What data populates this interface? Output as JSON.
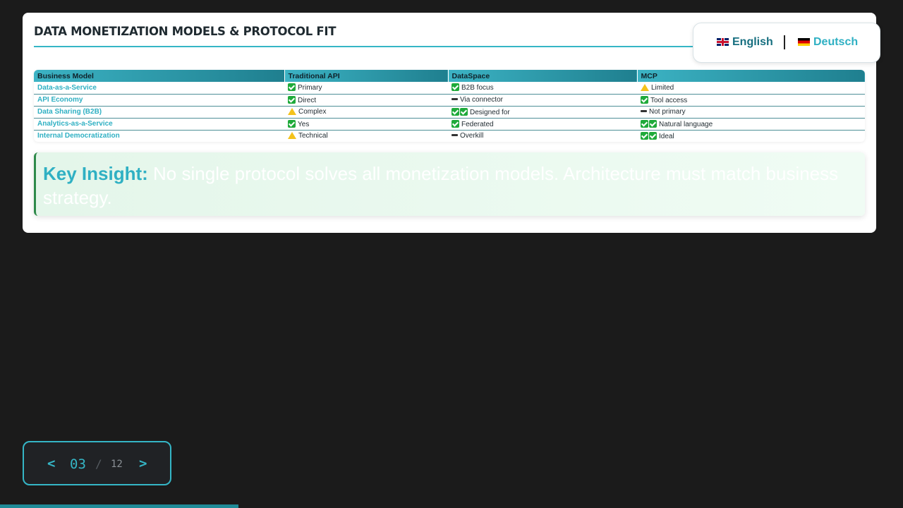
{
  "slide": {
    "title": "DATA MONETIZATION MODELS & PROTOCOL FIT",
    "table": {
      "headers": [
        "Business Model",
        "Traditional API",
        "DataSpace",
        "MCP"
      ],
      "rows": [
        {
          "model": "Data-as-a-Service",
          "api": {
            "icon": "check",
            "text": "Primary"
          },
          "dataspace": {
            "icon": "check",
            "text": "B2B focus"
          },
          "mcp": {
            "icon": "warning",
            "text": "Limited"
          }
        },
        {
          "model": "API Economy",
          "api": {
            "icon": "check",
            "text": "Direct"
          },
          "dataspace": {
            "icon": "dash",
            "text": "Via connector"
          },
          "mcp": {
            "icon": "check",
            "text": "Tool access"
          }
        },
        {
          "model": "Data Sharing (B2B)",
          "api": {
            "icon": "warning",
            "text": "Complex"
          },
          "dataspace": {
            "icon": "double-check",
            "text": "Designed for"
          },
          "mcp": {
            "icon": "dash",
            "text": "Not primary"
          }
        },
        {
          "model": "Analytics-as-a-Service",
          "api": {
            "icon": "check",
            "text": "Yes"
          },
          "dataspace": {
            "icon": "check",
            "text": "Federated"
          },
          "mcp": {
            "icon": "double-check",
            "text": "Natural language"
          }
        },
        {
          "model": "Internal Democratization",
          "api": {
            "icon": "warning",
            "text": "Technical"
          },
          "dataspace": {
            "icon": "dash",
            "text": "Overkill"
          },
          "mcp": {
            "icon": "double-check",
            "text": "Ideal"
          }
        }
      ]
    },
    "insight": {
      "label": "Key Insight:",
      "text": "No single protocol solves all monetization models. Architecture must match business strategy."
    }
  },
  "language": {
    "english": "English",
    "deutsch": "Deutsch",
    "active": "English"
  },
  "pager": {
    "prev": "<",
    "next": ">",
    "current": "03",
    "separator": "/",
    "total": "12",
    "progress_fraction": 0.264
  },
  "colors": {
    "accent": "#35b6c6",
    "check": "#1faa3a",
    "warning": "#f4c21b",
    "background": "#1b1b1b"
  }
}
